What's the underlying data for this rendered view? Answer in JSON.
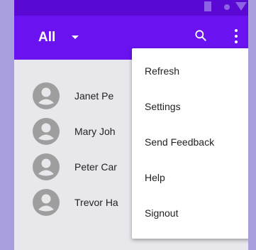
{
  "status_bar": {},
  "app_bar": {
    "title": "All",
    "icons": [
      "chevron-down-icon",
      "search-icon",
      "more-vert-icon"
    ]
  },
  "contacts": [
    {
      "name": "Janet Pe"
    },
    {
      "name": "Mary Joh"
    },
    {
      "name": "Peter Car"
    },
    {
      "name": "Trevor Ha"
    }
  ],
  "overflow_menu": {
    "items": [
      {
        "label": "Refresh"
      },
      {
        "label": "Settings"
      },
      {
        "label": "Send Feedback"
      },
      {
        "label": "Help"
      },
      {
        "label": "Signout"
      }
    ]
  },
  "colors": {
    "app_bar": "#6a12f0",
    "status_bar": "#5a09d4",
    "background": "#a99fde",
    "avatar": "#9e9e9e"
  }
}
